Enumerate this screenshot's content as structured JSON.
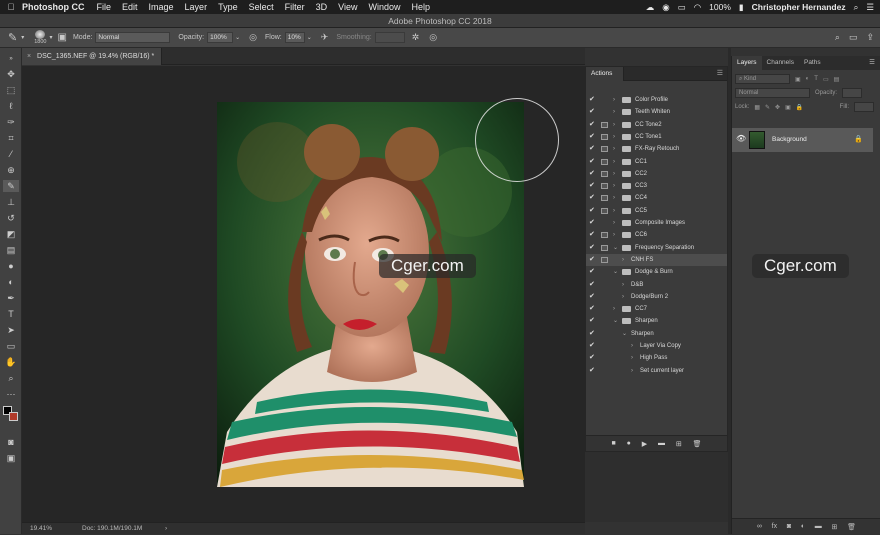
{
  "menubar": {
    "app_name": "Photoshop CC",
    "items": [
      "File",
      "Edit",
      "Image",
      "Layer",
      "Type",
      "Select",
      "Filter",
      "3D",
      "View",
      "Window",
      "Help"
    ],
    "battery": "100%",
    "user": "Christopher Hernandez"
  },
  "window_title": "Adobe Photoshop CC 2018",
  "options": {
    "brush_size": "1800",
    "mode_label": "Mode:",
    "mode_value": "Normal",
    "opacity_label": "Opacity:",
    "opacity_value": "100%",
    "flow_label": "Flow:",
    "flow_value": "10%",
    "smoothing_label": "Smoothing:"
  },
  "document_tab": {
    "label": "DSC_1365.NEF @ 19.4% (RGB/16) *"
  },
  "status": {
    "zoom": "19.41%",
    "doc": "Doc: 190.1M/190.1M"
  },
  "watermark": "Cger.com",
  "actions": {
    "tab": "Actions",
    "items": [
      {
        "label": "Color Profile",
        "type": "set",
        "indent": 0,
        "checked": true,
        "box": false
      },
      {
        "label": "Teeth Whiten",
        "type": "set",
        "indent": 0,
        "checked": true,
        "box": false
      },
      {
        "label": "CC Tone2",
        "type": "set",
        "indent": 0,
        "checked": true,
        "box": true
      },
      {
        "label": "CC Tone1",
        "type": "set",
        "indent": 0,
        "checked": true,
        "box": true
      },
      {
        "label": "FX-Ray Retouch",
        "type": "set",
        "indent": 0,
        "checked": true,
        "box": true
      },
      {
        "label": "CC1",
        "type": "set",
        "indent": 0,
        "checked": true,
        "box": true
      },
      {
        "label": "CC2",
        "type": "set",
        "indent": 0,
        "checked": true,
        "box": true
      },
      {
        "label": "CC3",
        "type": "set",
        "indent": 0,
        "checked": true,
        "box": true
      },
      {
        "label": "CC4",
        "type": "set",
        "indent": 0,
        "checked": true,
        "box": true
      },
      {
        "label": "CC5",
        "type": "set",
        "indent": 0,
        "checked": true,
        "box": true
      },
      {
        "label": "Composite Images",
        "type": "set",
        "indent": 0,
        "checked": true,
        "box": false
      },
      {
        "label": "CC6",
        "type": "set",
        "indent": 0,
        "checked": true,
        "box": true
      },
      {
        "label": "Frequency Separation",
        "type": "set-open",
        "indent": 0,
        "checked": true,
        "box": true
      },
      {
        "label": "CNH FS",
        "type": "action",
        "indent": 1,
        "checked": true,
        "box": true,
        "selected": true
      },
      {
        "label": "Dodge & Burn",
        "type": "set-open",
        "indent": 0,
        "checked": true,
        "box": false
      },
      {
        "label": "D&B",
        "type": "action",
        "indent": 1,
        "checked": true,
        "box": false
      },
      {
        "label": "Dodge/Burn 2",
        "type": "action",
        "indent": 1,
        "checked": true,
        "box": false
      },
      {
        "label": "CC7",
        "type": "set",
        "indent": 0,
        "checked": true,
        "box": false
      },
      {
        "label": "Sharpen",
        "type": "set-open",
        "indent": 0,
        "checked": true,
        "box": false
      },
      {
        "label": "Sharpen",
        "type": "action-open",
        "indent": 1,
        "checked": true,
        "box": false
      },
      {
        "label": "Layer Via Copy",
        "type": "step",
        "indent": 2,
        "checked": true,
        "box": false
      },
      {
        "label": "High Pass",
        "type": "step",
        "indent": 2,
        "checked": true,
        "box": false
      },
      {
        "label": "Set current layer",
        "type": "step",
        "indent": 2,
        "checked": true,
        "box": false
      }
    ]
  },
  "layers_panel": {
    "tabs": [
      "Layers",
      "Channels",
      "Paths"
    ],
    "filter_placeholder": "Kind",
    "blend": "Normal",
    "opacity_label": "Opacity:",
    "lock_label": "Lock:",
    "fill_label": "Fill:",
    "layer_name": "Background"
  }
}
